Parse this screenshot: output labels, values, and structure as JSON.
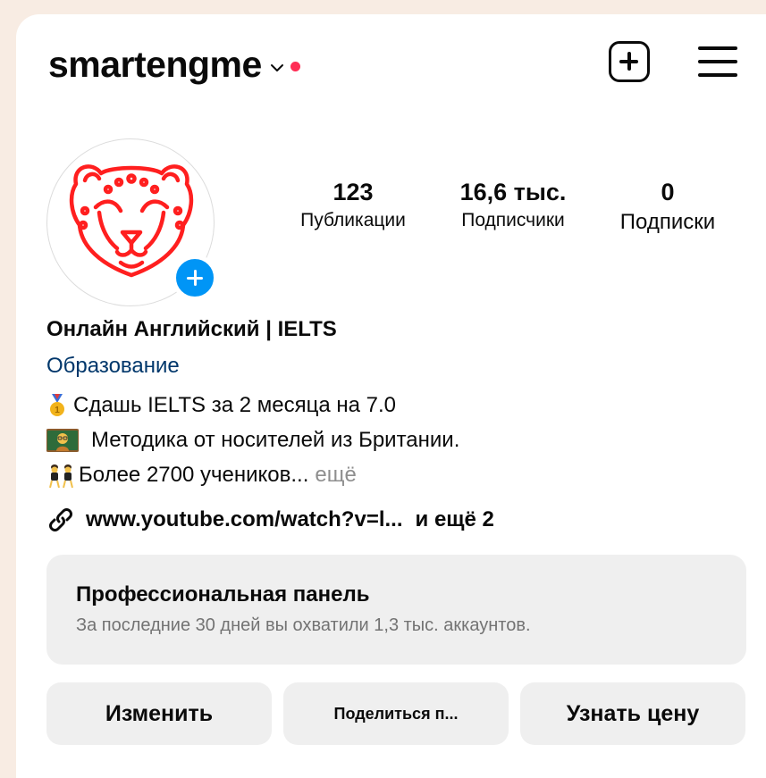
{
  "header": {
    "username": "smartengme",
    "icons": {
      "dropdown": "chevron-down-icon",
      "notification": "red-dot",
      "create": "plus-square-icon",
      "menu": "hamburger-menu-icon"
    }
  },
  "avatar": {
    "icon": "leopard-logo",
    "add_icon": "plus-circle-icon",
    "logo_color": "#ff1f1f",
    "add_color": "#0095f6"
  },
  "stats": [
    {
      "value": "123",
      "label": "Публикации"
    },
    {
      "value": "16,6 тыс.",
      "label": "Подписчики"
    },
    {
      "value": "0",
      "label": "Подписки"
    }
  ],
  "profile": {
    "name": "Онлайн Английский | IELTS",
    "category": "Образование",
    "bio": [
      {
        "emoji": "medal-emoji",
        "text": "Сдашь IELTS за 2 месяца на 7.0"
      },
      {
        "emoji": "teacher-emoji",
        "text": "Методика от носителей из Британии."
      },
      {
        "emoji": "dancers-emoji",
        "text": "Более 2700 учеников...",
        "more": "ещё"
      }
    ],
    "link": {
      "icon": "link-icon",
      "url": "www.youtube.com/watch?v=l...",
      "extra": "и ещё 2"
    }
  },
  "pro_panel": {
    "title": "Профессиональная панель",
    "subtitle": "За последние 30 дней вы охватили 1,3 тыс. аккаунтов."
  },
  "buttons": {
    "edit": "Изменить",
    "share": "Поделиться п...",
    "price": "Узнать цену"
  },
  "colors": {
    "page_bg": "#f8ece3",
    "category": "#00376b",
    "muted": "#8e8e8e",
    "button_bg": "#efefef"
  }
}
